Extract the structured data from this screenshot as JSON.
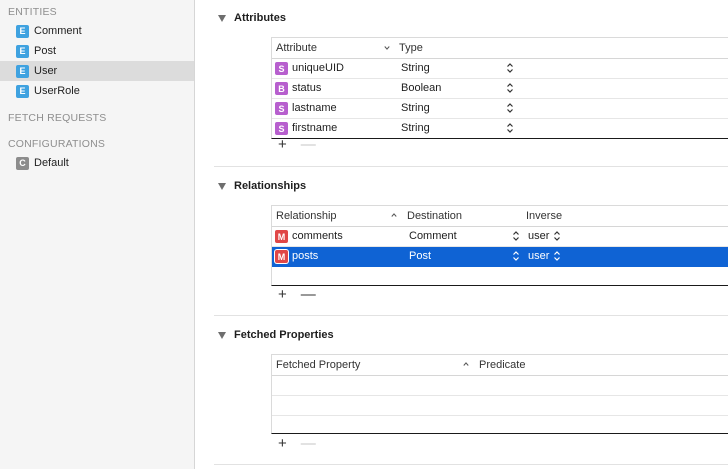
{
  "sidebar": {
    "entities_title": "ENTITIES",
    "entities": [
      {
        "badge": "E",
        "label": "Comment"
      },
      {
        "badge": "E",
        "label": "Post"
      },
      {
        "badge": "E",
        "label": "User"
      },
      {
        "badge": "E",
        "label": "UserRole"
      }
    ],
    "selected_entity": "User",
    "fetch_requests_title": "FETCH REQUESTS",
    "configurations_title": "CONFIGURATIONS",
    "configurations": [
      {
        "badge": "C",
        "label": "Default"
      }
    ]
  },
  "attributes": {
    "title": "Attributes",
    "col_attribute": "Attribute",
    "col_type": "Type",
    "rows": [
      {
        "badge": "S",
        "name": "uniqueUID",
        "type": "String"
      },
      {
        "badge": "B",
        "name": "status",
        "type": "Boolean"
      },
      {
        "badge": "S",
        "name": "lastname",
        "type": "String"
      },
      {
        "badge": "S",
        "name": "firstname",
        "type": "String"
      }
    ],
    "add_label": "+",
    "remove_label": "—"
  },
  "relationships": {
    "title": "Relationships",
    "col_relationship": "Relationship",
    "col_destination": "Destination",
    "col_inverse": "Inverse",
    "rows": [
      {
        "badge": "M",
        "name": "comments",
        "destination": "Comment",
        "inverse": "user"
      },
      {
        "badge": "M",
        "name": "posts",
        "destination": "Post",
        "inverse": "user"
      }
    ],
    "selected_row": "posts",
    "add_label": "+",
    "remove_label": "—"
  },
  "fetched_properties": {
    "title": "Fetched Properties",
    "col_fetched_property": "Fetched Property",
    "col_predicate": "Predicate",
    "add_label": "+",
    "remove_label": "—"
  },
  "colors": {
    "entity_badge": "#3fa2e0",
    "config_badge": "#8c8c8c",
    "string_badge": "#b75fce",
    "boolean_badge": "#b75fce",
    "relationship_badge": "#e04747",
    "selection": "#0f63d4"
  }
}
